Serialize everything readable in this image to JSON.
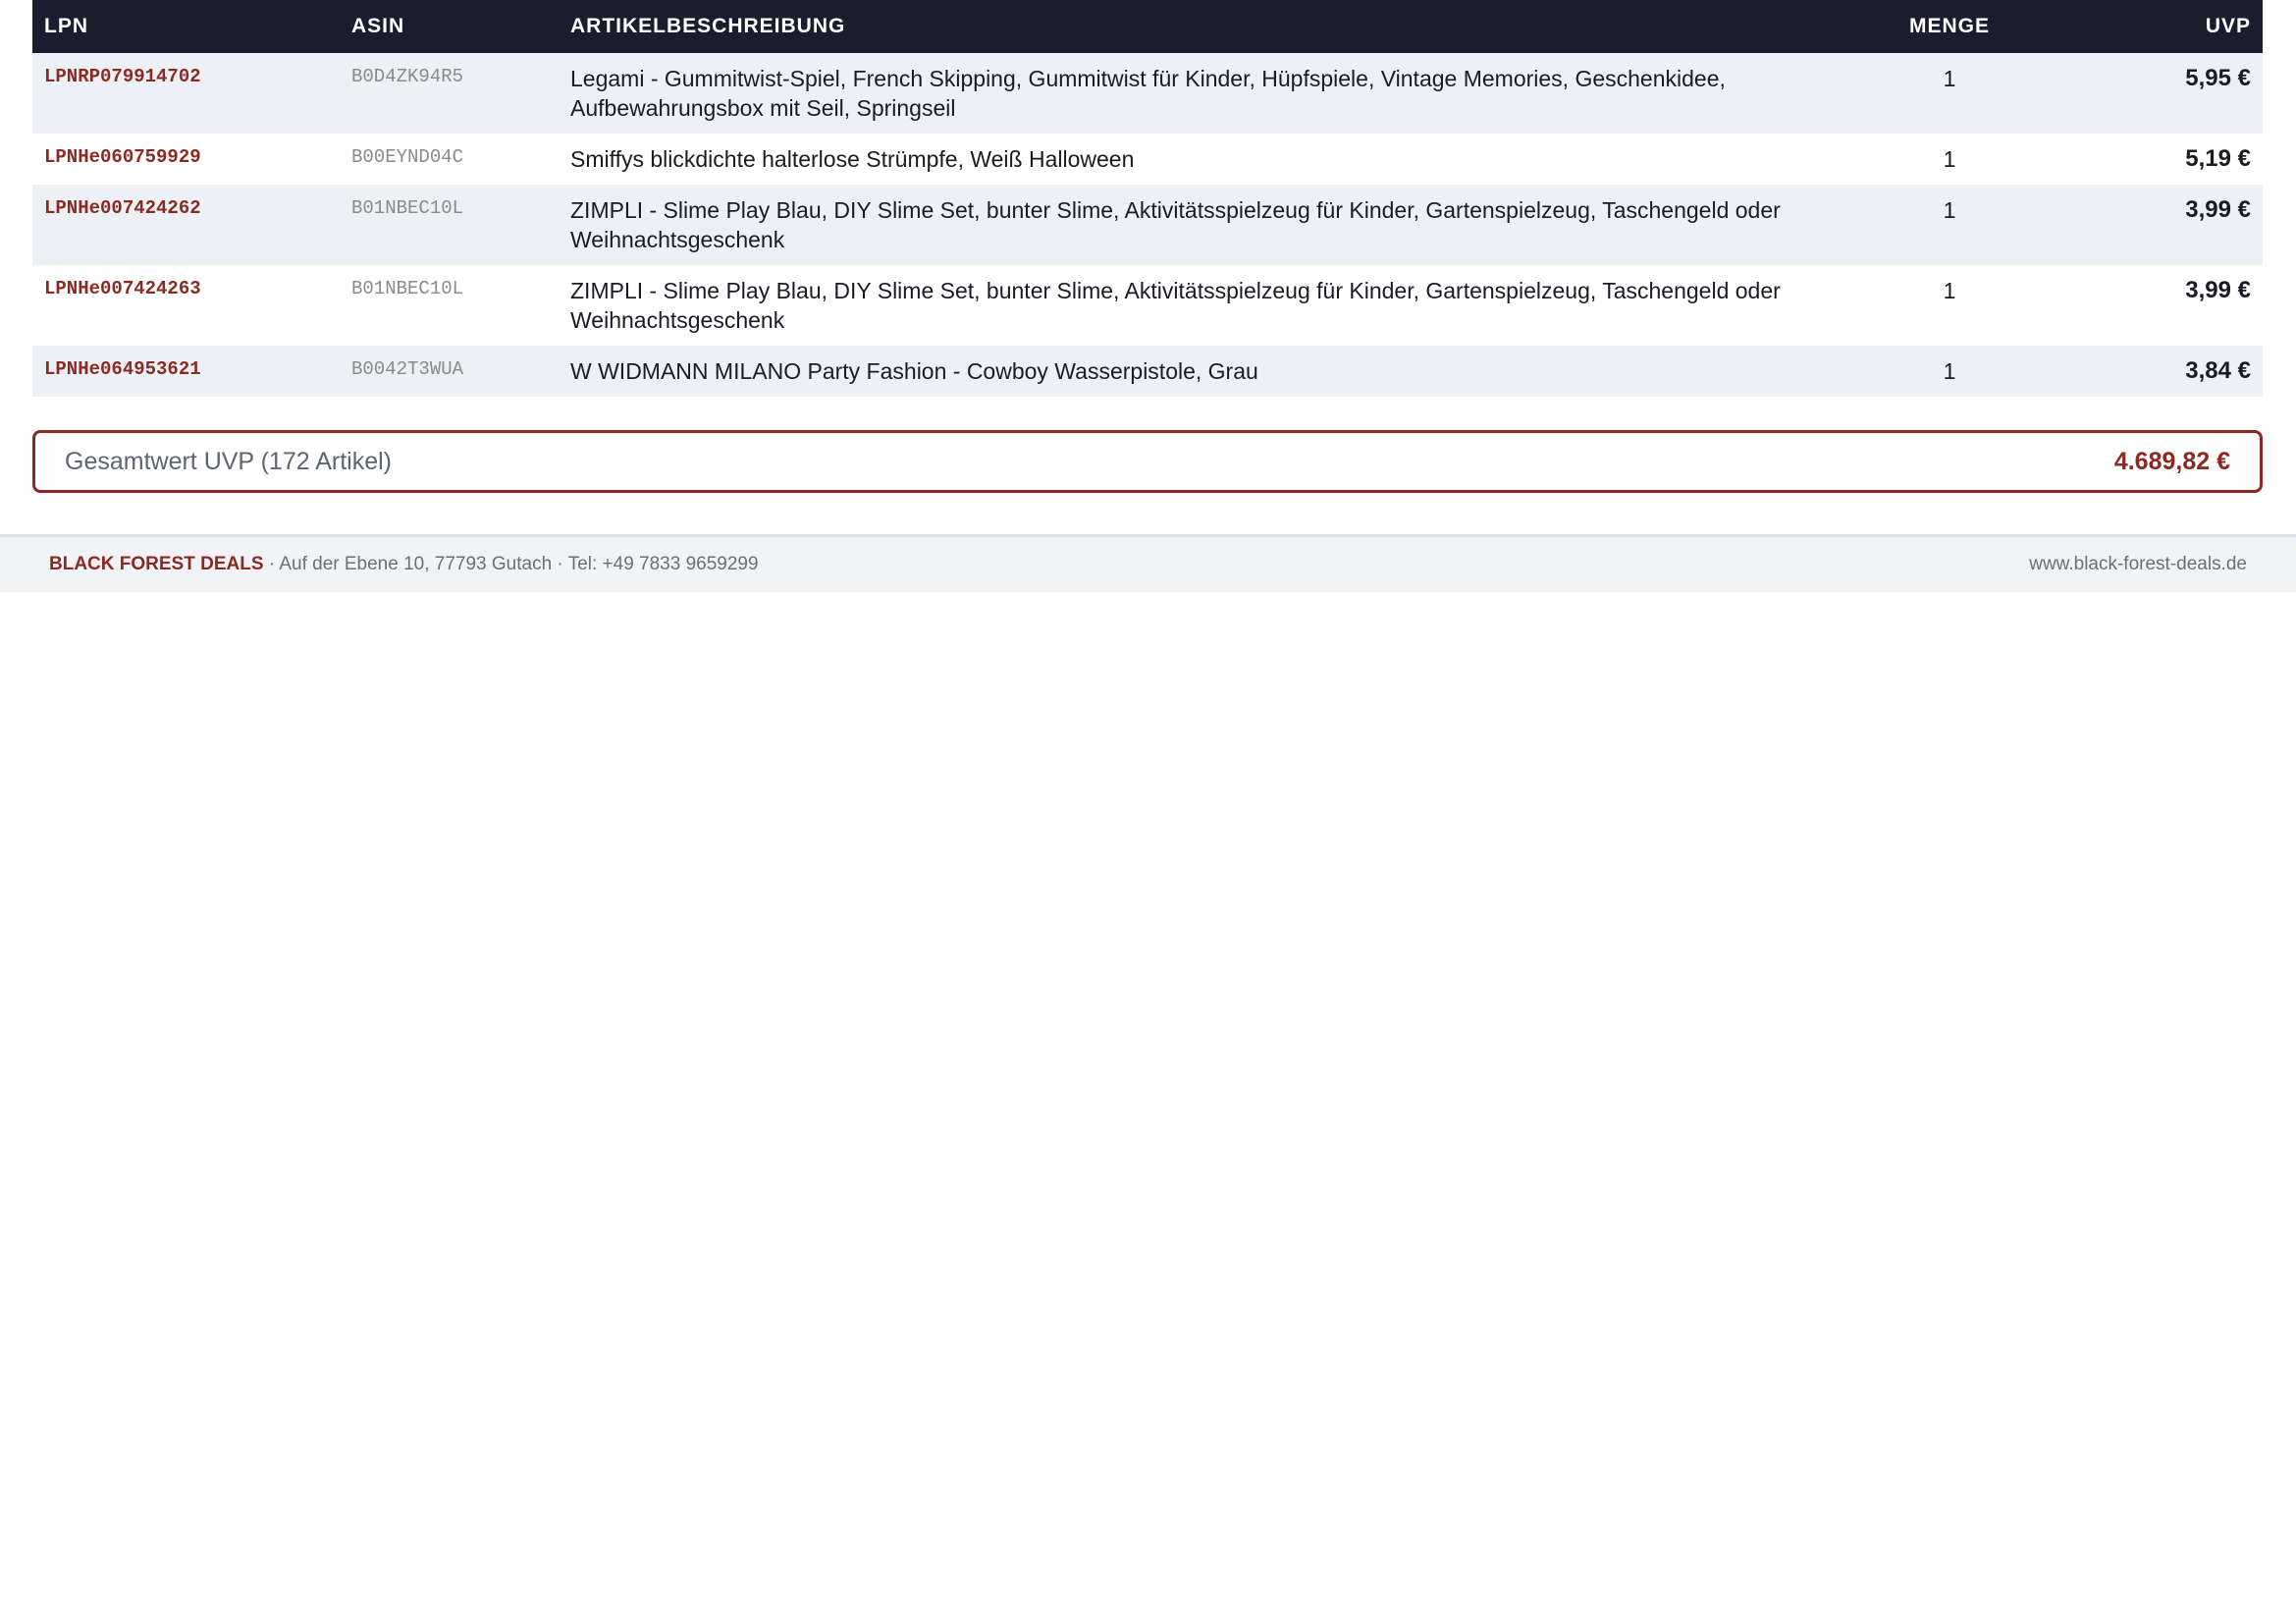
{
  "table": {
    "headers": {
      "lpn": "LPN",
      "asin": "ASIN",
      "description": "ARTIKELBESCHREIBUNG",
      "quantity": "MENGE",
      "price": "UVP"
    },
    "rows": [
      {
        "lpn": "LPNRP079914702",
        "asin": "B0D4ZK94R5",
        "description": "Legami - Gummitwist-Spiel, French Skipping, Gummitwist für Kinder, Hüpfspiele, Vintage Memories, Geschenkidee, Aufbewahrungsbox mit Seil, Springseil",
        "quantity": "1",
        "price": "5,95 €"
      },
      {
        "lpn": "LPNHe060759929",
        "asin": "B00EYND04C",
        "description": "Smiffys blickdichte halterlose Strümpfe, Weiß Halloween",
        "quantity": "1",
        "price": "5,19 €"
      },
      {
        "lpn": "LPNHe007424262",
        "asin": "B01NBEC10L",
        "description": "ZIMPLI - Slime Play Blau, DIY Slime Set, bunter Slime, Aktivitätsspielzeug für Kinder, Gartenspielzeug, Taschengeld oder Weihnachtsgeschenk",
        "quantity": "1",
        "price": "3,99 €"
      },
      {
        "lpn": "LPNHe007424263",
        "asin": "B01NBEC10L",
        "description": "ZIMPLI - Slime Play Blau, DIY Slime Set, bunter Slime, Aktivitätsspielzeug für Kinder, Gartenspielzeug, Taschengeld oder Weihnachtsgeschenk",
        "quantity": "1",
        "price": "3,99 €"
      },
      {
        "lpn": "LPNHe064953621",
        "asin": "B0042T3WUA",
        "description": "W WIDMANN MILANO Party Fashion - Cowboy Wasserpistole, Grau",
        "quantity": "1",
        "price": "3,84 €"
      }
    ]
  },
  "total": {
    "label": "Gesamtwert UVP (172 Artikel)",
    "value": "4.689,82 €"
  },
  "footer": {
    "brand": "BLACK FOREST DEALS",
    "address": " · Auf der Ebene 10, 77793 Gutach · Tel: +49 7833 9659299",
    "website": "www.black-forest-deals.de"
  },
  "colors": {
    "header_bg": "#1b1c2e",
    "accent": "#8b2a22",
    "row_alt_bg": "#edf1f6"
  }
}
